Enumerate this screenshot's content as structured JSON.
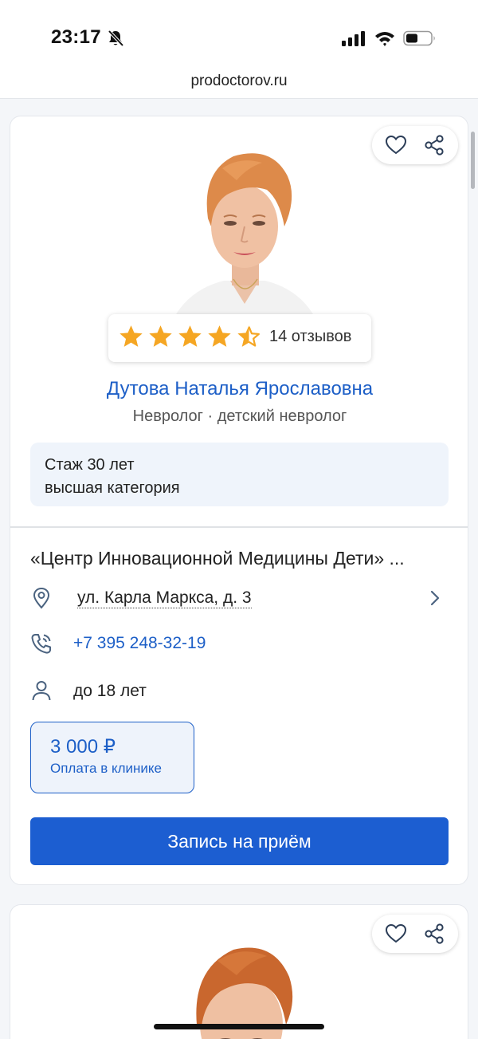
{
  "status_bar": {
    "time": "23:17",
    "icons": [
      "bell-off-icon",
      "signal-icon",
      "wifi-icon",
      "battery-icon"
    ]
  },
  "browser": {
    "url": "prodoctorov.ru"
  },
  "colors": {
    "accent": "#1d5fc7",
    "button": "#1c5ed1",
    "star": "#f5a623",
    "info_bg": "#eff4fb"
  },
  "doctor_card": {
    "actions": [
      "heart-icon",
      "share-icon"
    ],
    "rating_stars": 4.5,
    "reviews": "14 отзывов",
    "name": "Дутова Наталья Ярославовна",
    "specialty": "Невролог · детский невролог",
    "experience": "Стаж 30 лет",
    "category": "высшая категория",
    "clinic": "«Центр Инновационной Медицины Дети» ...",
    "address": "ул. Карла Маркса, д. 3",
    "phone": "+7 395 248-32-19",
    "age": "до 18 лет",
    "price": "3 000 ₽",
    "price_note": "Оплата в клинике",
    "book_button": "Запись на приём"
  },
  "next_card": {
    "actions": [
      "heart-icon",
      "share-icon"
    ]
  }
}
